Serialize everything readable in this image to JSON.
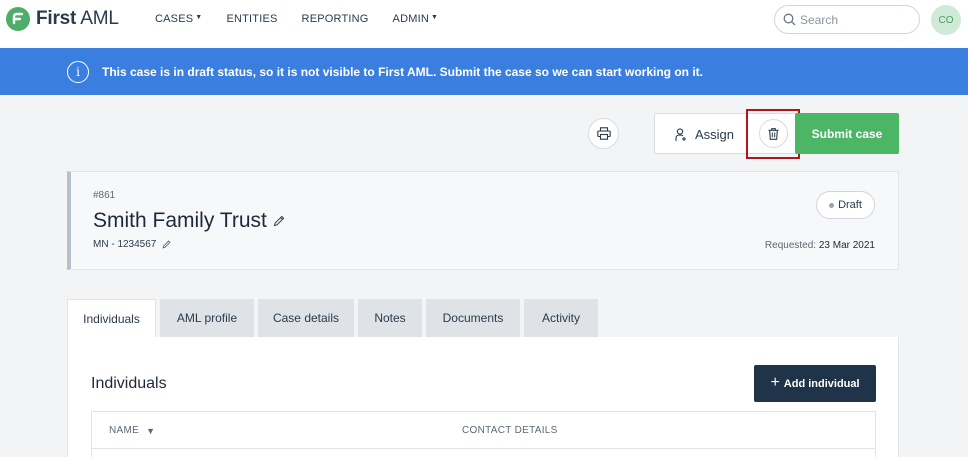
{
  "app": {
    "logo_text_bold": "First",
    "logo_text_light": "AML",
    "brand_color": "#4cae68"
  },
  "nav": {
    "items": [
      {
        "label": "CASES",
        "has_dropdown": true
      },
      {
        "label": "ENTITIES",
        "has_dropdown": false
      },
      {
        "label": "REPORTING",
        "has_dropdown": false
      },
      {
        "label": "ADMIN",
        "has_dropdown": true
      }
    ]
  },
  "search": {
    "placeholder": "Search",
    "icon": "search-icon"
  },
  "user": {
    "initials": "CO"
  },
  "banner": {
    "text": "This case is in draft status, so it is not visible to First AML. Submit the case so we can start working on it.",
    "icon": "info-icon",
    "color": "#3a7ee0"
  },
  "actions": {
    "print_icon": "print-icon",
    "assign_label": "Assign",
    "delete_icon": "trash-icon",
    "submit_label": "Submit case",
    "submit_color": "#4cb566"
  },
  "case": {
    "number": "#861",
    "title": "Smith Family Trust",
    "reference": "MN - 1234567",
    "status": "Draft",
    "requested_label": "Requested:",
    "requested_date": "23 Mar 2021"
  },
  "tabs": [
    {
      "label": "Individuals",
      "active": true
    },
    {
      "label": "AML profile",
      "active": false
    },
    {
      "label": "Case details",
      "active": false
    },
    {
      "label": "Notes",
      "active": false
    },
    {
      "label": "Documents",
      "active": false
    },
    {
      "label": "Activity",
      "active": false
    }
  ],
  "individuals": {
    "title": "Individuals",
    "add_label": "Add individual",
    "columns": [
      {
        "label": "NAME",
        "sortable": true
      },
      {
        "label": "CONTACT DETAILS",
        "sortable": false
      }
    ]
  }
}
